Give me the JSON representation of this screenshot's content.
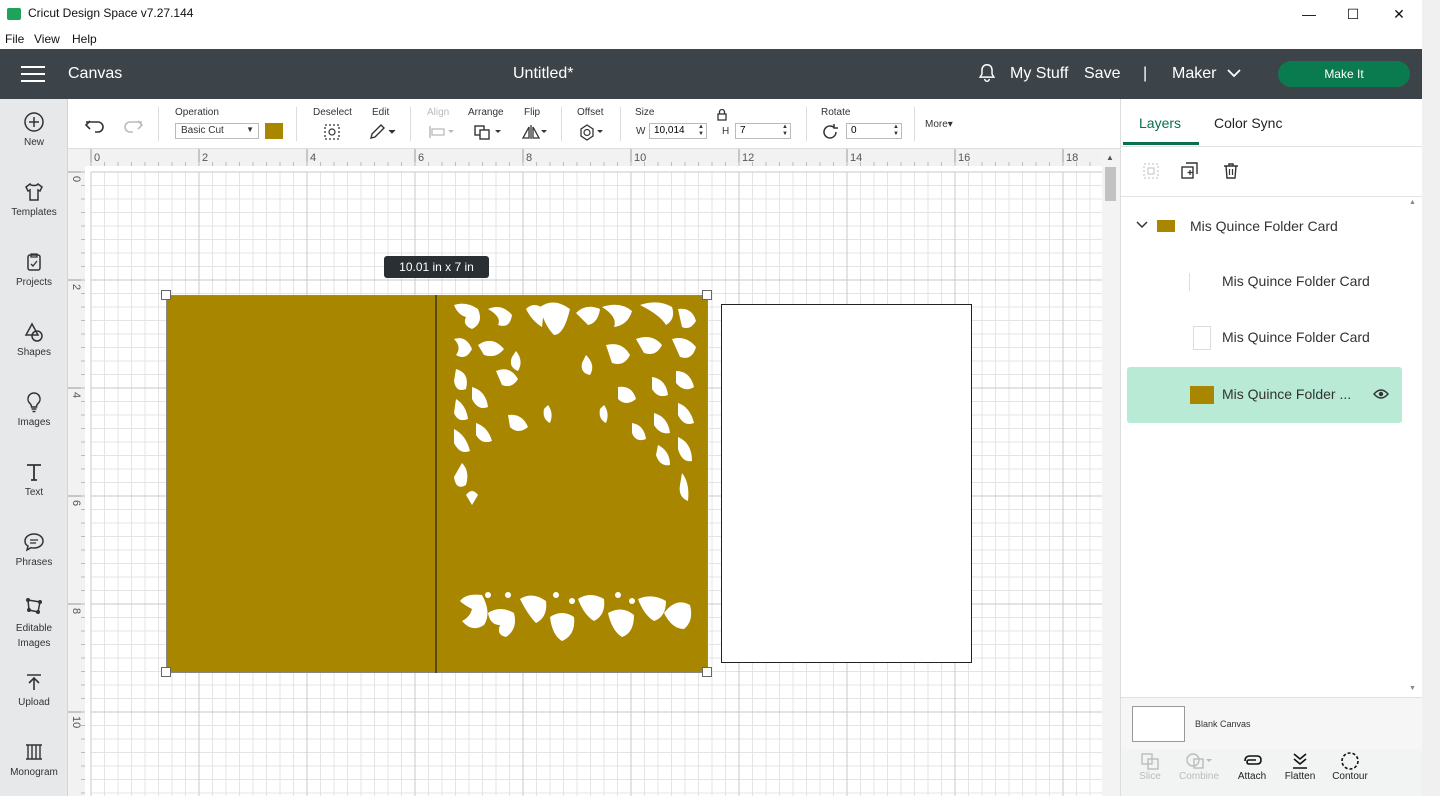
{
  "window": {
    "title": "Cricut Design Space  v7.27.144",
    "minimize": "—",
    "maximize": "☐",
    "close": "✕"
  },
  "menu": {
    "file": "File",
    "view": "View",
    "help": "Help"
  },
  "header": {
    "section": "Canvas",
    "document_title": "Untitled*",
    "my_stuff": "My Stuff",
    "save": "Save",
    "separator": "|",
    "machine": "Maker",
    "make_it": "Make It"
  },
  "sidebar": {
    "items": [
      {
        "label": "New",
        "icon": "plus-circle-icon"
      },
      {
        "label": "Templates",
        "icon": "shirt-icon"
      },
      {
        "label": "Projects",
        "icon": "projects-icon"
      },
      {
        "label": "Shapes",
        "icon": "shapes-icon"
      },
      {
        "label": "Images",
        "icon": "lightbulb-icon"
      },
      {
        "label": "Text",
        "icon": "text-icon"
      },
      {
        "label": "Phrases",
        "icon": "speech-bubble-icon"
      },
      {
        "label": "Editable Images",
        "icon": "edit-image-icon"
      },
      {
        "label": "Upload",
        "icon": "upload-icon"
      },
      {
        "label": "Monogram",
        "icon": "monogram-icon"
      }
    ]
  },
  "toolbar": {
    "operation_label": "Operation",
    "operation_value": "Basic Cut",
    "operation_color": "#a88600",
    "deselect_label": "Deselect",
    "edit_label": "Edit",
    "align_label": "Align",
    "arrange_label": "Arrange",
    "flip_label": "Flip",
    "offset_label": "Offset",
    "size_label": "Size",
    "width_prefix": "W",
    "width_value": "10,014",
    "height_prefix": "H",
    "height_value": "7",
    "rotate_label": "Rotate",
    "rotate_value": "0",
    "more_label": "More▾"
  },
  "ruler": {
    "top_ticks": [
      "0",
      "2",
      "4",
      "6",
      "8",
      "10",
      "12",
      "14",
      "16",
      "18"
    ],
    "left_ticks": [
      "0",
      "2",
      "4",
      "6",
      "8",
      "10"
    ]
  },
  "canvas": {
    "size_tooltip": "10.01  in x 7  in",
    "card_color": "#a88600"
  },
  "panel": {
    "tab_layers": "Layers",
    "tab_color_sync": "Color Sync",
    "group_name": "Mis Quince Folder Card",
    "layers": [
      {
        "name": "Mis Quince Folder Card"
      },
      {
        "name": "Mis Quince Folder Card"
      },
      {
        "name": "Mis Quince Folder ..."
      }
    ],
    "blank_canvas": "Blank Canvas",
    "actions": {
      "slice": "Slice",
      "combine": "Combine",
      "attach": "Attach",
      "flatten": "Flatten",
      "contour": "Contour"
    }
  }
}
